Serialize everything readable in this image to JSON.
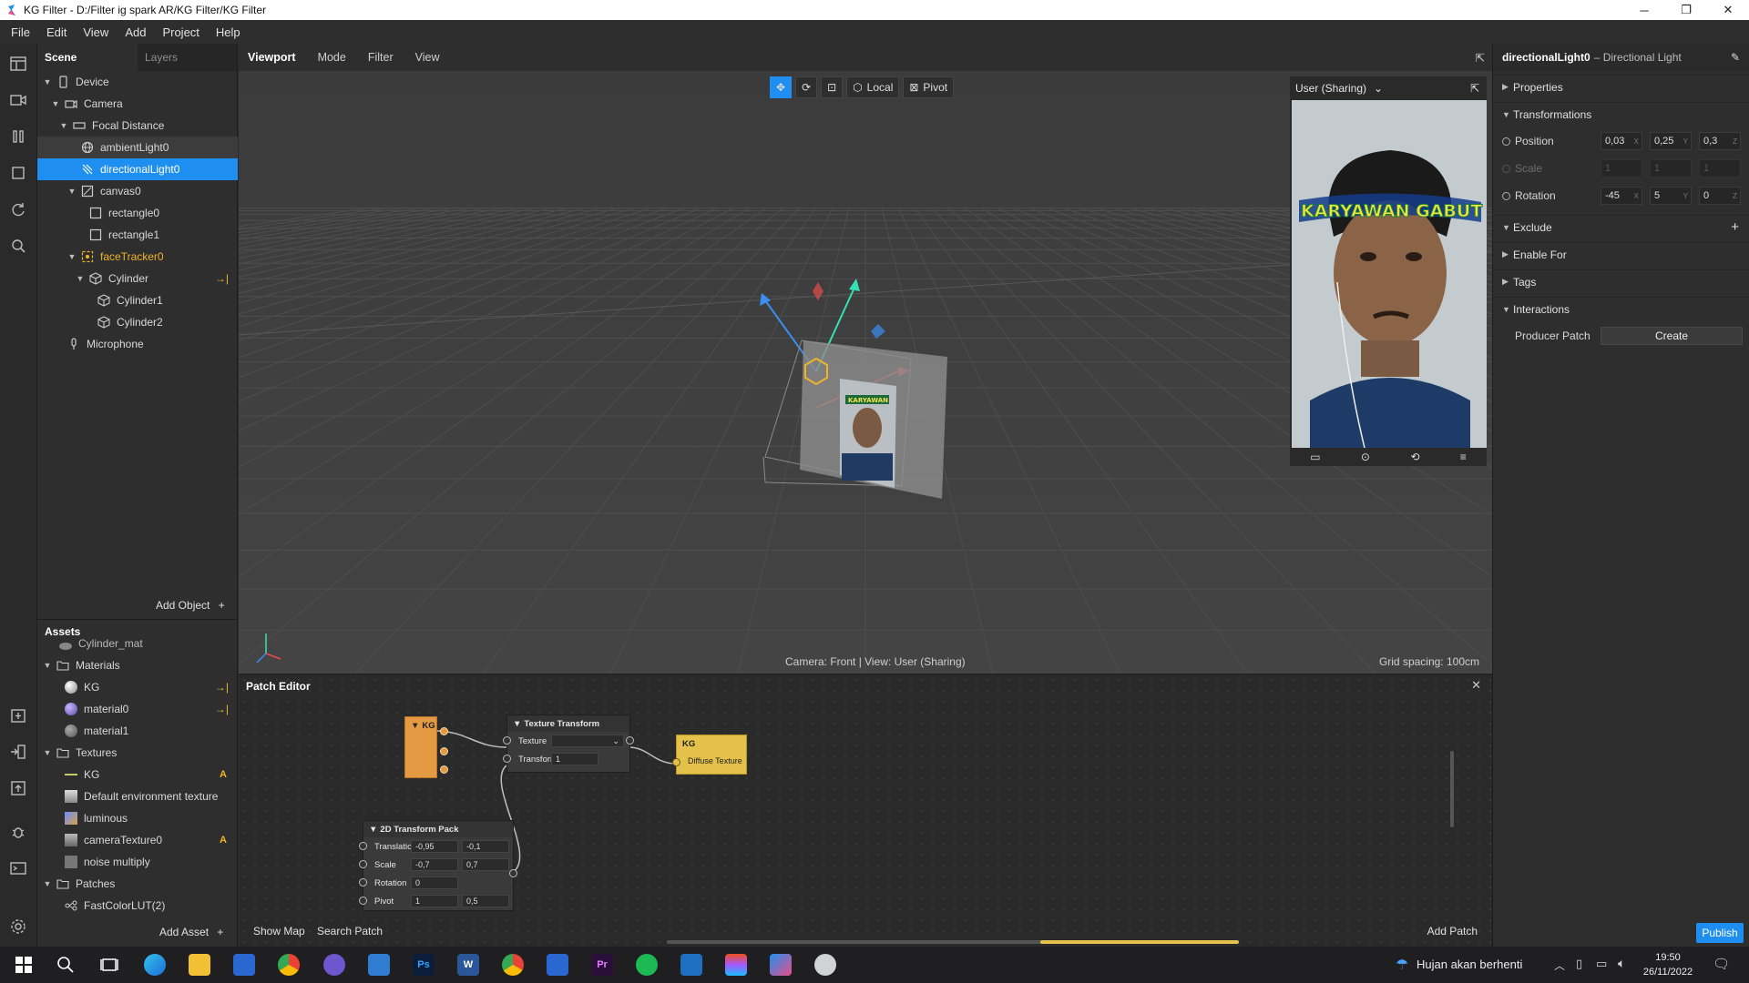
{
  "window": {
    "title": "KG Filter - D:/Filter ig spark AR/KG Filter/KG Filter",
    "controls": [
      "─",
      "❐",
      "✕"
    ]
  },
  "menu": [
    "File",
    "Edit",
    "View",
    "Add",
    "Project",
    "Help"
  ],
  "scene": {
    "tabs": [
      "Scene",
      "Layers"
    ],
    "tree": [
      {
        "label": "Device",
        "depth": 0
      },
      {
        "label": "Camera",
        "depth": 1
      },
      {
        "label": "Focal Distance",
        "depth": 2
      },
      {
        "label": "ambientLight0",
        "depth": 3
      },
      {
        "label": "directionalLight0",
        "depth": 3
      },
      {
        "label": "canvas0",
        "depth": 2
      },
      {
        "label": "rectangle0",
        "depth": 3
      },
      {
        "label": "rectangle1",
        "depth": 3
      },
      {
        "label": "faceTracker0",
        "depth": 2
      },
      {
        "label": "Cylinder",
        "depth": 3
      },
      {
        "label": "Cylinder1",
        "depth": 4
      },
      {
        "label": "Cylinder2",
        "depth": 4
      },
      {
        "label": "Microphone",
        "depth": 1
      }
    ],
    "add_object": "Add Object"
  },
  "assets": {
    "title": "Assets",
    "items": [
      {
        "label": "Cylinder_mat"
      },
      {
        "label": "Materials"
      },
      {
        "label": "KG"
      },
      {
        "label": "material0"
      },
      {
        "label": "material1"
      },
      {
        "label": "Textures"
      },
      {
        "label": "KG",
        "badge": "A"
      },
      {
        "label": "Default environment texture"
      },
      {
        "label": "luminous"
      },
      {
        "label": "cameraTexture0",
        "badge": "A"
      },
      {
        "label": "noise multiply"
      },
      {
        "label": "Patches"
      },
      {
        "label": "FastColorLUT(2)"
      }
    ],
    "add_asset": "Add Asset"
  },
  "viewport": {
    "tabs": [
      "Viewport",
      "Mode",
      "Filter",
      "View"
    ],
    "toolbar": {
      "local": "Local",
      "pivot": "Pivot"
    },
    "camera_status": "Camera: Front | View: User (Sharing)",
    "grid_spacing": "Grid spacing: 100cm",
    "preview_device": "User (Sharing)",
    "preview_overlay_text": "KARYAWAN GABUT"
  },
  "patch_editor": {
    "title": "Patch Editor",
    "nodes": {
      "kg_source": {
        "title": "KG"
      },
      "texture_transform": {
        "title": "Texture Transform",
        "rows": [
          "Texture",
          "Transform"
        ],
        "transform_value": "1"
      },
      "kg_material": {
        "title": "KG",
        "port": "Diffuse Texture"
      },
      "transform_pack": {
        "title": "2D Transform Pack",
        "translation_label": "Translation",
        "translation": [
          "-0,95",
          "-0,1"
        ],
        "scale_label": "Scale",
        "scale": [
          "-0,7",
          "0,7"
        ],
        "rotation_label": "Rotation",
        "rotation": "0",
        "pivot_label": "Pivot",
        "pivot": [
          "1",
          "0,5"
        ]
      }
    },
    "show_map": "Show Map",
    "search_patch": "Search Patch",
    "add_patch": "Add Patch"
  },
  "inspector": {
    "object": "directionalLight0",
    "type": "– Directional Light",
    "sections": {
      "properties": "Properties",
      "transformations": "Transformations",
      "exclude": "Exclude",
      "enable_for": "Enable For",
      "tags": "Tags",
      "interactions": "Interactions"
    },
    "position_label": "Position",
    "position": [
      "0,03",
      "0,25",
      "0,3"
    ],
    "scale_label": "Scale",
    "scale": [
      "1",
      "1",
      "1"
    ],
    "rotation_label": "Rotation",
    "rotation": [
      "-45",
      "5",
      "0"
    ],
    "axes": [
      "X",
      "Y",
      "Z"
    ],
    "producer_patch_label": "Producer Patch",
    "create": "Create",
    "publish": "Publish"
  },
  "taskbar": {
    "weather": "Hujan akan berhenti",
    "time": "19:50",
    "date": "26/11/2022",
    "app_labels": [
      "Ps",
      "W",
      "Pr"
    ]
  },
  "colors": {
    "accent": "#1e8ff0",
    "orange": "#f0b429",
    "patch_yellow": "#e3c14a",
    "patch_orange": "#e39a43"
  }
}
